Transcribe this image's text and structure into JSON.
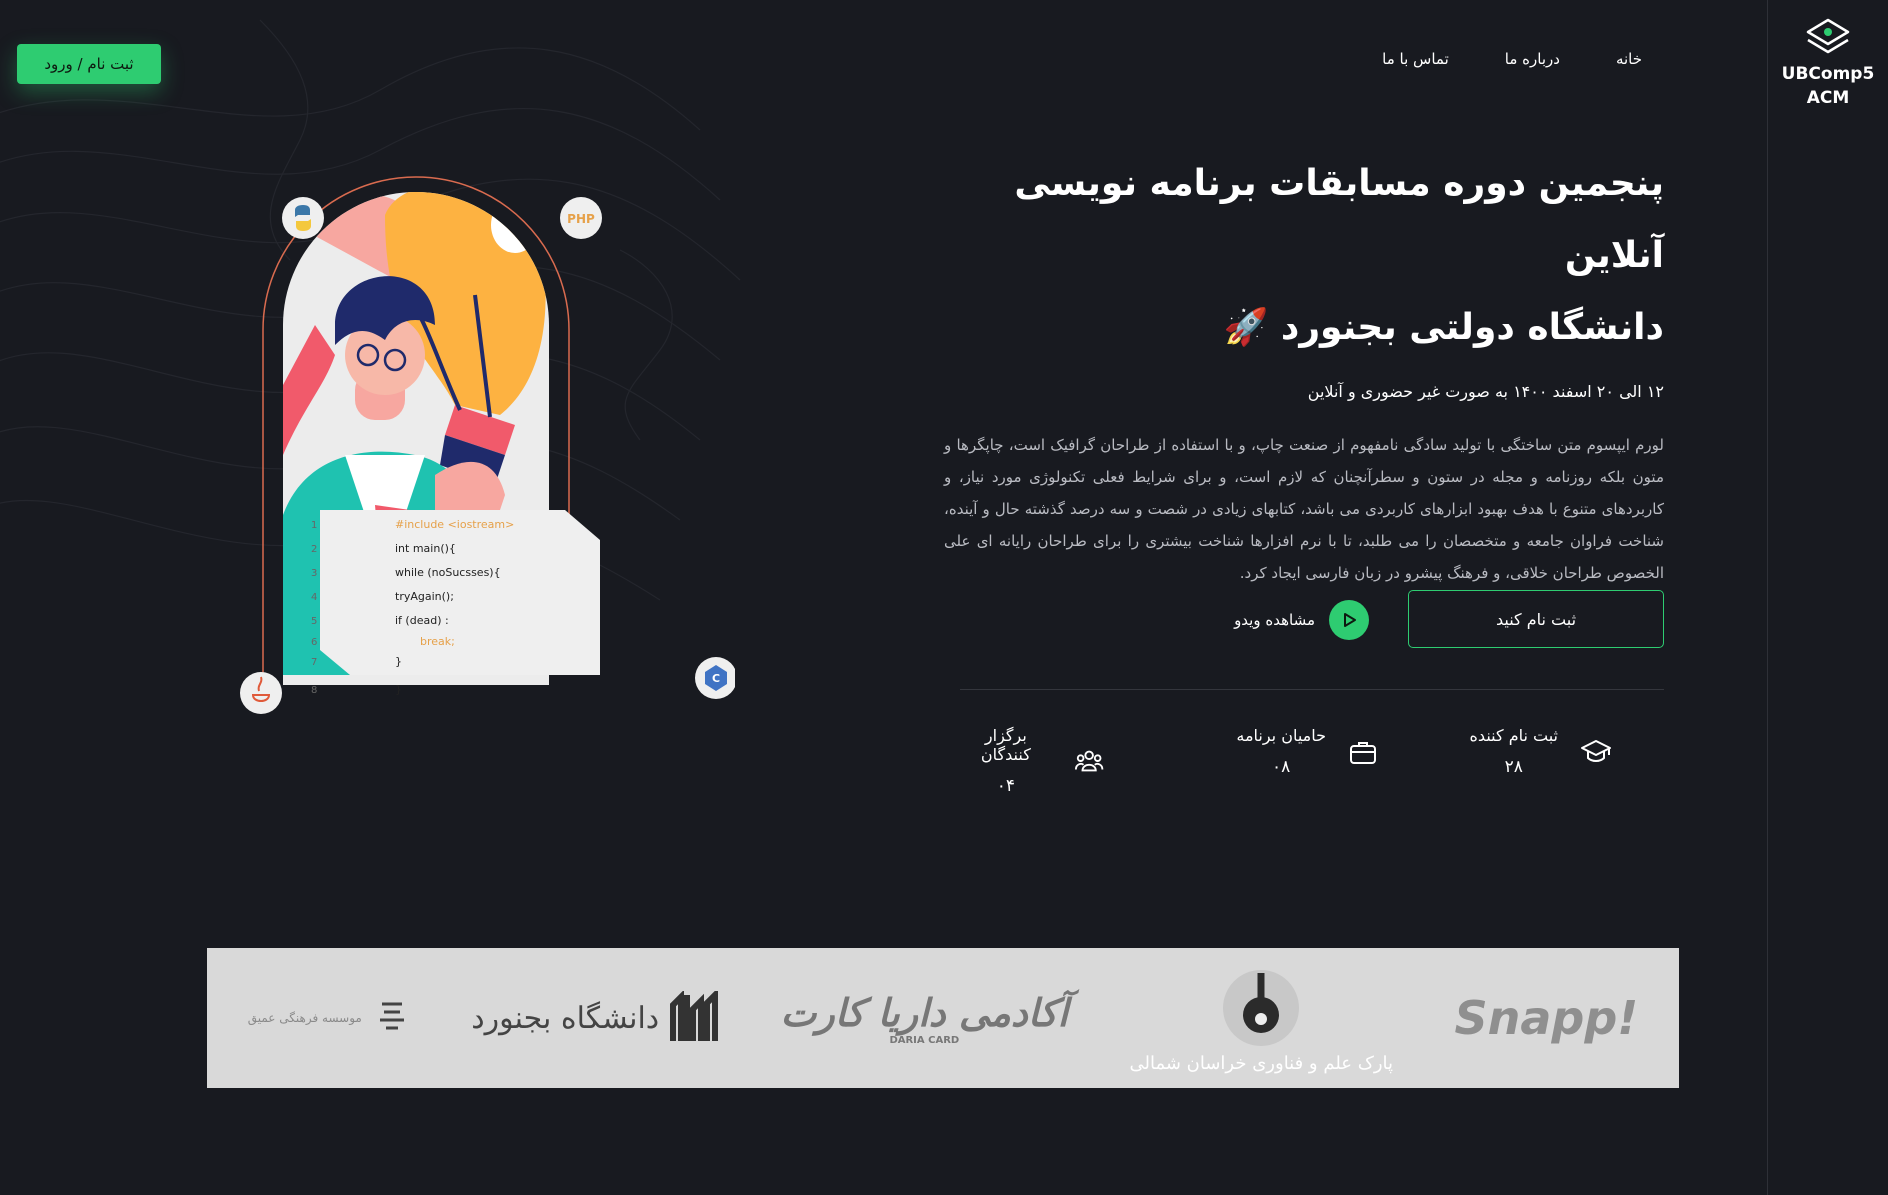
{
  "brand": {
    "name_line1": "UBComp5",
    "name_line2": "ACM",
    "accent": "#2ecc71"
  },
  "top_button": {
    "label": "ثبت نام / ورود"
  },
  "nav": {
    "items": [
      "خانه",
      "درباره ما",
      "تماس با ما"
    ]
  },
  "hero": {
    "title_line1": "پنجمین دوره مسابقات برنامه نویسی آنلاین",
    "title_line2": "دانشگاه دولتی بجنورد",
    "title_emoji": "🚀",
    "subtitle": "۱۲ الی ۲۰ اسفند ۱۴۰۰ به صورت غیر حضوری و آنلاین",
    "paragraph": "لورم ایپسوم متن ساختگی با تولید سادگی نامفهوم از صنعت چاپ، و با استفاده از طراحان گرافیک است، چاپگرها و متون بلکه روزنامه و مجله در ستون و سطرآنچنان که لازم است، و برای شرایط فعلی تکنولوژی مورد نیاز، و کاربردهای متنوع با هدف بهبود ابزارهای کاربردی می باشد، کتابهای زیادی در شصت و سه درصد گذشته حال و آینده، شناخت فراوان جامعه و متخصصان را می طلبد، تا با نرم افزارها شناخت بیشتری را برای طراحان رایانه ای علی الخصوص طراحان خلاقی، و فرهنگ پیشرو در زبان فارسی ایجاد کرد."
  },
  "cta": {
    "register_label": "ثبت نام کنید",
    "video_label": "مشاهده ویدو"
  },
  "stats": [
    {
      "label": "ثبت نام کننده",
      "value": "۲۸",
      "icon": "graduation-cap-icon"
    },
    {
      "label": "حامیان برنامه",
      "value": "۰۸",
      "icon": "briefcase-icon"
    },
    {
      "label": "برگزار کنندگان",
      "value": "۰۴",
      "icon": "users-icon"
    }
  ],
  "code_snippet": {
    "line_numbers": [
      "1",
      "2",
      "3",
      "4",
      "5",
      "6",
      "7",
      "8"
    ],
    "lines": [
      "#include <iostream>",
      "int main(){",
      "while (noSucsses){",
      "tryAgain();",
      "if (dead) :",
      "break;",
      "}",
      "}"
    ]
  },
  "badges": {
    "php": "PHP"
  },
  "sponsors": {
    "snapp": "Snapp!",
    "daria": "آکادمی داریا کارت",
    "daria_sub": "DARIA CARD",
    "park": "پارک علم و فناوری خراسان شمالی",
    "university": "دانشگاه بجنورد",
    "institute": "موسسه فرهنگی عمیق"
  }
}
